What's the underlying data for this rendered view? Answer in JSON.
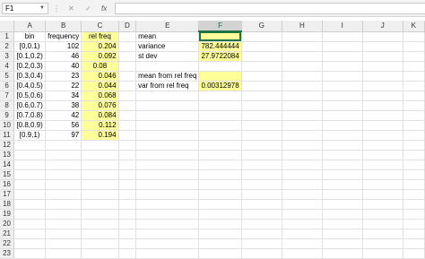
{
  "formula_bar": {
    "name_box": "F1",
    "cancel_icon": "✕",
    "enter_icon": "✓",
    "fx_label": "fx",
    "formula": ""
  },
  "columns": [
    "A",
    "B",
    "C",
    "D",
    "E",
    "F",
    "G",
    "H",
    "I",
    "J",
    "K"
  ],
  "selected_column": "F",
  "row_numbers": [
    "1",
    "2",
    "3",
    "4",
    "5",
    "6",
    "7",
    "8",
    "9",
    "10",
    "11",
    "12",
    "13",
    "14",
    "15",
    "16",
    "17",
    "18",
    "19",
    "20",
    "21",
    "22",
    "23"
  ],
  "table": {
    "headers": {
      "bin": "bin",
      "frequency": "frequency",
      "rel_freq": "rel freq"
    },
    "rows": [
      {
        "bin": "[0,0.1)",
        "frequency": "102",
        "rel_freq": "0.204"
      },
      {
        "bin": "[0.1,0.2)",
        "frequency": "46",
        "rel_freq": "0.092"
      },
      {
        "bin": "[0.2,0.3)",
        "frequency": "40",
        "rel_freq": "0.08"
      },
      {
        "bin": "[0.3,0.4)",
        "frequency": "23",
        "rel_freq": "0.046"
      },
      {
        "bin": "[0.4,0.5)",
        "frequency": "22",
        "rel_freq": "0.044"
      },
      {
        "bin": "[0.5,0.6)",
        "frequency": "34",
        "rel_freq": "0.068"
      },
      {
        "bin": "[0.6,0.7)",
        "frequency": "38",
        "rel_freq": "0.076"
      },
      {
        "bin": "[0.7,0.8)",
        "frequency": "42",
        "rel_freq": "0.084"
      },
      {
        "bin": "[0.8,0.9)",
        "frequency": "56",
        "rel_freq": "0.112"
      },
      {
        "bin": "[0.9,1)",
        "frequency": "97",
        "rel_freq": "0.194"
      }
    ]
  },
  "stats": {
    "mean_label": "mean",
    "mean_value": "",
    "variance_label": "variance",
    "variance_value": "782.444444",
    "stdev_label": "st dev",
    "stdev_value": "27.9722084",
    "mean_rel_label": "mean from rel freq",
    "mean_rel_value": "",
    "var_rel_label": "var from rel freq",
    "var_rel_value": "0.00312978"
  },
  "colors": {
    "highlight": "#ffff99",
    "selection": "#217346"
  }
}
